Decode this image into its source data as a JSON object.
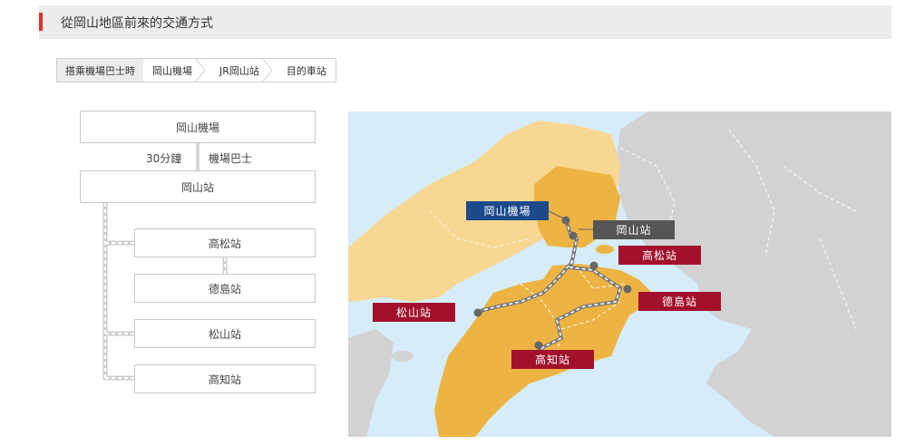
{
  "header": {
    "title": "從岡山地區前來的交通方式"
  },
  "breadcrumb": {
    "items": [
      "搭乘機場巴士時",
      "岡山機場",
      "JR岡山站",
      "目的車站"
    ]
  },
  "route": {
    "origin": "岡山機場",
    "duration": "30分鐘",
    "transport": "機場巴士",
    "hub": "岡山站",
    "stations": [
      "高松站",
      "德島站",
      "松山站",
      "高知站"
    ]
  },
  "map": {
    "labels": {
      "airport": "岡山機場",
      "okayama": "岡山站",
      "takamatsu": "高松站",
      "tokushima": "德島站",
      "matsuyama": "松山站",
      "kochi": "高知站"
    },
    "colors": {
      "sea": "#d6ecf8",
      "land_gray": "#d2d2d2",
      "land_light": "#f8d792",
      "land_orange": "#edb443",
      "label_red": "#a3102b",
      "label_blue": "#1c4a8c",
      "label_gray": "#555555"
    }
  }
}
